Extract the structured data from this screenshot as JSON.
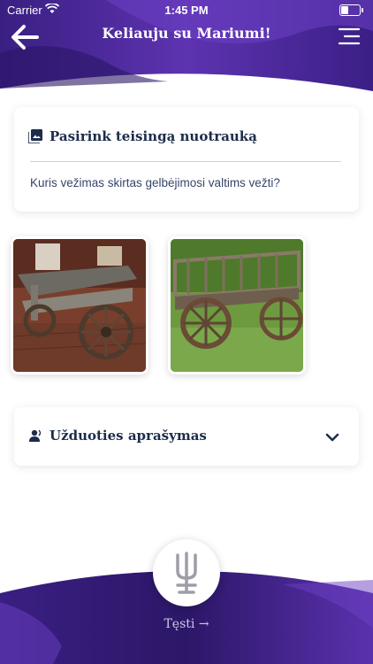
{
  "status_bar": {
    "carrier": "Carrier",
    "time": "1:45 PM",
    "battery_level": 0.35
  },
  "header": {
    "title": "Keliauju su  Mariumi!",
    "back_icon": "back-arrow-icon",
    "menu_icon": "menu-icon"
  },
  "question_card": {
    "heading": "Pasirink teisingą nuotrauką",
    "heading_icon": "image-icon",
    "question": "Kuris vežimas skirtas gelbėjimosi valtims vežti?"
  },
  "photos": [
    {
      "icon": "wagon-museum-photo"
    },
    {
      "icon": "wagon-grass-photo"
    }
  ],
  "description_card": {
    "heading": "Užduoties aprašymas",
    "heading_icon": "speaker-icon",
    "toggle_icon": "chevron-down-icon"
  },
  "footer": {
    "logo_icon": "trident-logo-icon",
    "continue_label": "Tęsti →"
  },
  "colors": {
    "brand_purple": "#4b2b9a",
    "brand_dark": "#2f1a6b",
    "text_dark": "#1c2c4a"
  }
}
